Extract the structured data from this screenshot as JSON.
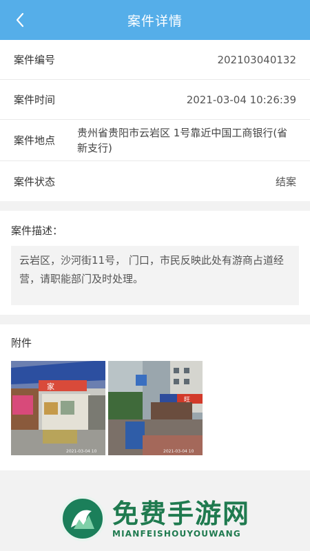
{
  "header": {
    "title": "案件详情",
    "back_icon": "chevron-left-icon"
  },
  "details": {
    "case_no_label": "案件编号",
    "case_no": "202103040132",
    "time_label": "案件时间",
    "time": "2021-03-04 10:26:39",
    "location_label": "案件地点",
    "location": "贵州省贵阳市云岩区 1号靠近中国工商银行(省新支行)",
    "status_label": "案件状态",
    "status": "结案"
  },
  "description": {
    "title": "案件描述：",
    "text": "云岩区，沙河街11号， 门口，市民反映此处有游商占道经营，请职能部门及时处理。"
  },
  "attachments": {
    "title": "附件",
    "images": [
      {
        "timestamp": "2021-03-04 10",
        "sign_text": "家"
      },
      {
        "timestamp": "2021-03-04 10",
        "sign_text": "旺"
      }
    ]
  },
  "watermark": {
    "main": "免费手游网",
    "sub": "MIANFEISHOUYOUWANG"
  },
  "colors": {
    "header": "#55aee9",
    "watermark": "#1f7a4f"
  }
}
